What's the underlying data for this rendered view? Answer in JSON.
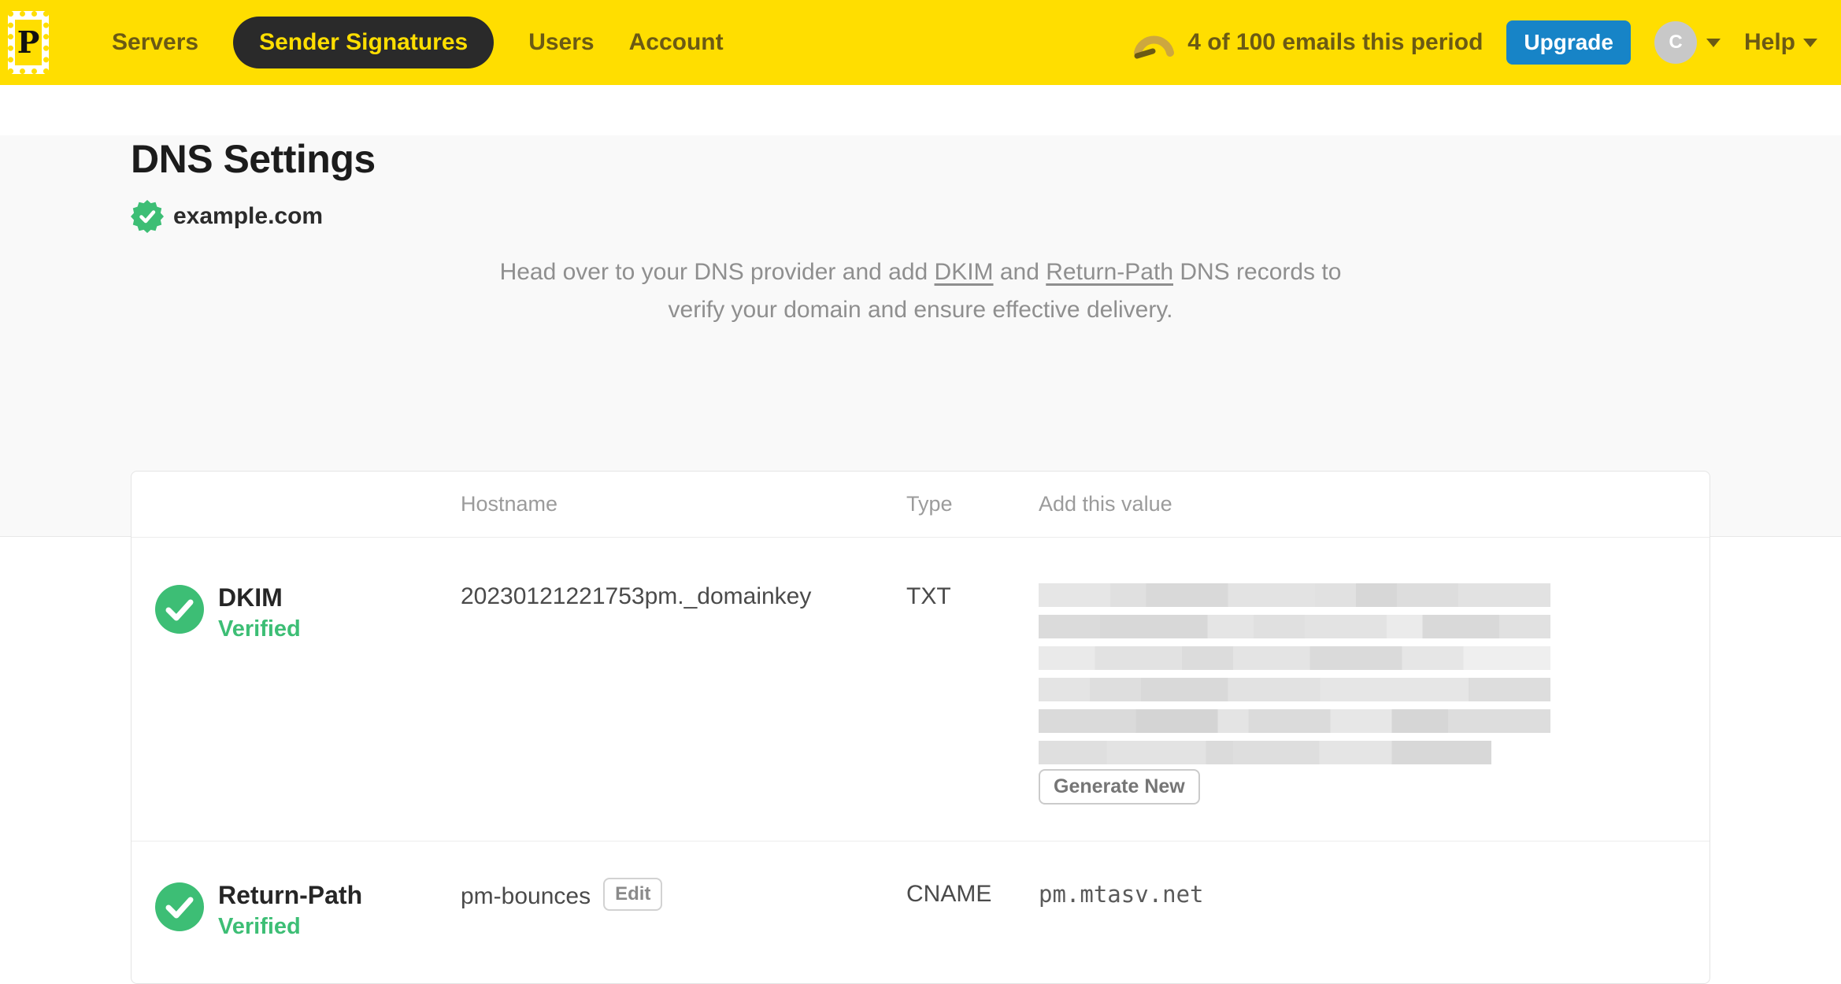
{
  "nav": {
    "logo_letter": "P",
    "items": [
      {
        "label": "Servers",
        "active": false
      },
      {
        "label": "Sender Signatures",
        "active": true
      },
      {
        "label": "Users",
        "active": false
      },
      {
        "label": "Account",
        "active": false
      }
    ],
    "usage_text": "4 of 100 emails this period",
    "upgrade_label": "Upgrade",
    "avatar_initial": "C",
    "help_label": "Help"
  },
  "page": {
    "title": "DNS Settings",
    "domain": {
      "name": "example.com",
      "verified": true
    },
    "instructions": {
      "part1": "Head over to your DNS provider and add ",
      "dkim_link": "DKIM",
      "part2": " and ",
      "return_path_link": "Return-Path",
      "part3": " DNS records to",
      "line2": "verify your domain and ensure effective delivery."
    }
  },
  "table": {
    "headers": {
      "hostname": "Hostname",
      "type": "Type",
      "value": "Add this value"
    },
    "rows": [
      {
        "name": "DKIM",
        "status": "Verified",
        "hostname": "20230121221753pm._domainkey",
        "type": "TXT",
        "value_redacted": true,
        "action_label": "Generate New"
      },
      {
        "name": "Return-Path",
        "status": "Verified",
        "hostname": "pm-bounces",
        "hostname_action_label": "Edit",
        "type": "CNAME",
        "value": "pm.mtasv.net"
      }
    ]
  },
  "colors": {
    "brand_yellow": "#FFDE00",
    "nav_ink": "#6B5A14",
    "active_pill_bg": "#2A2A2A",
    "upgrade_blue": "#1784C7",
    "verified_green": "#3DBE75",
    "hero_bg": "#F9F9F9",
    "muted_text": "#8F8F8F"
  }
}
